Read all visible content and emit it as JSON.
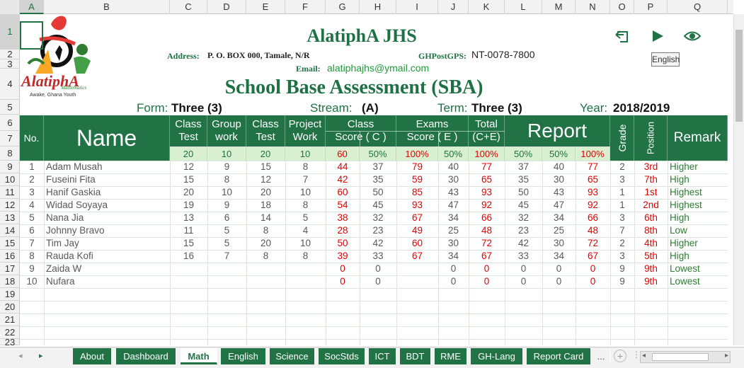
{
  "columns": [
    "A",
    "B",
    "C",
    "D",
    "E",
    "F",
    "G",
    "H",
    "I",
    "J",
    "K",
    "L",
    "M",
    "N",
    "O",
    "P",
    "Q"
  ],
  "rows": [
    "1",
    "2",
    "3",
    "4",
    "5",
    "6",
    "7",
    "8",
    "9",
    "10",
    "11",
    "12",
    "13",
    "14",
    "15",
    "16",
    "17",
    "18",
    "19",
    "20",
    "21",
    "22",
    "23"
  ],
  "school": {
    "name": "AlatiphA JHS",
    "address_label": "Address:",
    "address_value": "P. O. BOX 000, Tamale, N/R",
    "gps_label": "GHPostGPS:",
    "gps_value": "NT-0078-7800",
    "email_label": "Email:",
    "email_value": "alatiphajhs@ymail.com",
    "logo_text": "AlatiphA",
    "logo_sub": "Mathematics",
    "logo_motto": "Awake, Ghana Youth"
  },
  "title": "School Base Assessment (SBA)",
  "form": {
    "label": "Form:",
    "value": "Three (3)"
  },
  "stream": {
    "label": "Stream:",
    "value": "(A)"
  },
  "term": {
    "label": "Term:",
    "value": "Three (3)"
  },
  "year": {
    "label": "Year:",
    "value": "2018/2019"
  },
  "tooltip": "English",
  "icons": [
    "back-icon",
    "play-icon",
    "eye-icon"
  ],
  "headers": {
    "no": "No.",
    "name": "Name",
    "class_test_1": [
      "Class",
      "Test"
    ],
    "group_work": [
      "Group",
      "work"
    ],
    "class_test_2": [
      "Class",
      "Test"
    ],
    "project_work": [
      "Project",
      "Work"
    ],
    "class_score": [
      "Class",
      "Score ( C )"
    ],
    "exams_score": [
      "Exams",
      "Score ( E )"
    ],
    "total": [
      "Total",
      "(C+E)"
    ],
    "report": "Report",
    "grade": "Grade",
    "position": "Position",
    "remark": "Remark"
  },
  "subheaders": [
    "20",
    "10",
    "20",
    "10",
    "60",
    "50%",
    "100%",
    "50%",
    "100%",
    "50%",
    "50%",
    "100%"
  ],
  "students": [
    {
      "no": "1",
      "name": "Adam Musah",
      "ct1": "12",
      "gw": "9",
      "ct2": "15",
      "pw": "8",
      "cs": "44",
      "csp": "37",
      "ex": "79",
      "exp": "40",
      "tot": "77",
      "r1": "37",
      "r2": "40",
      "r3": "77",
      "grade": "2",
      "pos": "3rd",
      "remark": "Higher"
    },
    {
      "no": "2",
      "name": "Fuseini Fita",
      "ct1": "15",
      "gw": "8",
      "ct2": "12",
      "pw": "7",
      "cs": "42",
      "csp": "35",
      "ex": "59",
      "exp": "30",
      "tot": "65",
      "r1": "35",
      "r2": "30",
      "r3": "65",
      "grade": "3",
      "pos": "7th",
      "remark": "High"
    },
    {
      "no": "3",
      "name": "Hanif Gaskia",
      "ct1": "20",
      "gw": "10",
      "ct2": "20",
      "pw": "10",
      "cs": "60",
      "csp": "50",
      "ex": "85",
      "exp": "43",
      "tot": "93",
      "r1": "50",
      "r2": "43",
      "r3": "93",
      "grade": "1",
      "pos": "1st",
      "remark": "Highest"
    },
    {
      "no": "4",
      "name": "Widad Soyaya",
      "ct1": "19",
      "gw": "9",
      "ct2": "18",
      "pw": "8",
      "cs": "54",
      "csp": "45",
      "ex": "93",
      "exp": "47",
      "tot": "92",
      "r1": "45",
      "r2": "47",
      "r3": "92",
      "grade": "1",
      "pos": "2nd",
      "remark": "Highest"
    },
    {
      "no": "5",
      "name": "Nana Jia",
      "ct1": "13",
      "gw": "6",
      "ct2": "14",
      "pw": "5",
      "cs": "38",
      "csp": "32",
      "ex": "67",
      "exp": "34",
      "tot": "66",
      "r1": "32",
      "r2": "34",
      "r3": "66",
      "grade": "3",
      "pos": "6th",
      "remark": "High"
    },
    {
      "no": "6",
      "name": "Johnny Bravo",
      "ct1": "11",
      "gw": "5",
      "ct2": "8",
      "pw": "4",
      "cs": "28",
      "csp": "23",
      "ex": "49",
      "exp": "25",
      "tot": "48",
      "r1": "23",
      "r2": "25",
      "r3": "48",
      "grade": "7",
      "pos": "8th",
      "remark": "Low"
    },
    {
      "no": "7",
      "name": "Tim Jay",
      "ct1": "15",
      "gw": "5",
      "ct2": "20",
      "pw": "10",
      "cs": "50",
      "csp": "42",
      "ex": "60",
      "exp": "30",
      "tot": "72",
      "r1": "42",
      "r2": "30",
      "r3": "72",
      "grade": "2",
      "pos": "4th",
      "remark": "Higher"
    },
    {
      "no": "8",
      "name": "Rauda Kofi",
      "ct1": "16",
      "gw": "7",
      "ct2": "8",
      "pw": "8",
      "cs": "39",
      "csp": "33",
      "ex": "67",
      "exp": "34",
      "tot": "67",
      "r1": "33",
      "r2": "34",
      "r3": "67",
      "grade": "3",
      "pos": "5th",
      "remark": "High"
    },
    {
      "no": "9",
      "name": "Zaida W",
      "ct1": "",
      "gw": "",
      "ct2": "",
      "pw": "",
      "cs": "0",
      "csp": "0",
      "ex": "",
      "exp": "0",
      "tot": "0",
      "r1": "0",
      "r2": "0",
      "r3": "0",
      "grade": "9",
      "pos": "9th",
      "remark": "Lowest"
    },
    {
      "no": "10",
      "name": "Nufara",
      "ct1": "",
      "gw": "",
      "ct2": "",
      "pw": "",
      "cs": "0",
      "csp": "0",
      "ex": "",
      "exp": "0",
      "tot": "0",
      "r1": "0",
      "r2": "0",
      "r3": "0",
      "grade": "9",
      "pos": "9th",
      "remark": "Lowest"
    }
  ],
  "tabs": [
    "About",
    "Dashboard",
    "Math",
    "English",
    "Science",
    "SocStds",
    "ICT",
    "BDT",
    "RME",
    "GH-Lang",
    "Report Card",
    "..."
  ],
  "active_tab": "Math",
  "colors": {
    "green": "#217346",
    "accent": "#1e7145",
    "red": "#e00000",
    "light": "#d9f0d0"
  }
}
